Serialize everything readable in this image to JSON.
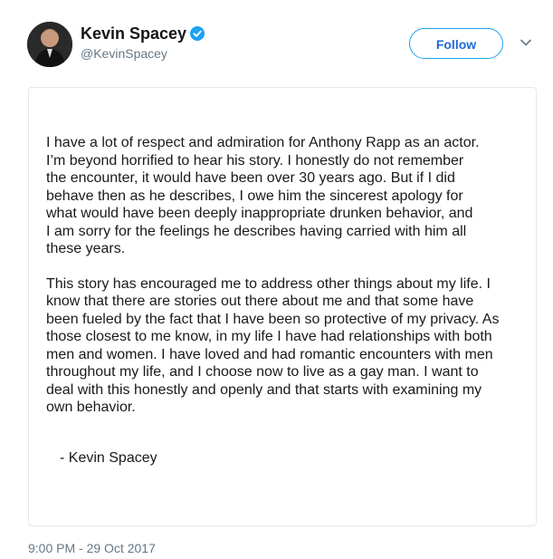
{
  "user": {
    "display_name": "Kevin Spacey",
    "handle": "@KevinSpacey",
    "verified": true
  },
  "follow_button": {
    "label": "Follow"
  },
  "statement": {
    "paragraph1": [
      "I have a lot of respect and admiration for Anthony Rapp as an actor.",
      "I’m beyond horrified to hear his story. I honestly do not remember",
      "the encounter, it would have been over 30 years ago. But if I did",
      "behave then as he describes, I owe him the sincerest apology for",
      "what would have been deeply inappropriate drunken behavior, and",
      "I am sorry for the feelings he describes having carried with him all",
      "these years."
    ],
    "paragraph2": [
      "This story has encouraged me to address other things about my life. I",
      "know that there are stories out there about me and that some have",
      "been fueled by the fact that I have been so protective of my privacy. As",
      "those closest to me know, in my life I have had relationships with both",
      "men and women. I have loved and had romantic encounters with men",
      "throughout my life, and I choose now to live as a gay man.  I want to",
      "deal with this honestly and openly and that starts with examining my",
      "own behavior."
    ],
    "signature": "- Kevin Spacey"
  },
  "timestamp": "9:00 PM - 29 Oct 2017",
  "colors": {
    "accent": "#1da1f2",
    "follow_text": "#1d6bd6",
    "secondary_text": "#657786",
    "card_border": "#e1e8ed"
  },
  "icons": {
    "verified": "verified-badge-icon",
    "caret": "chevron-down-icon"
  }
}
